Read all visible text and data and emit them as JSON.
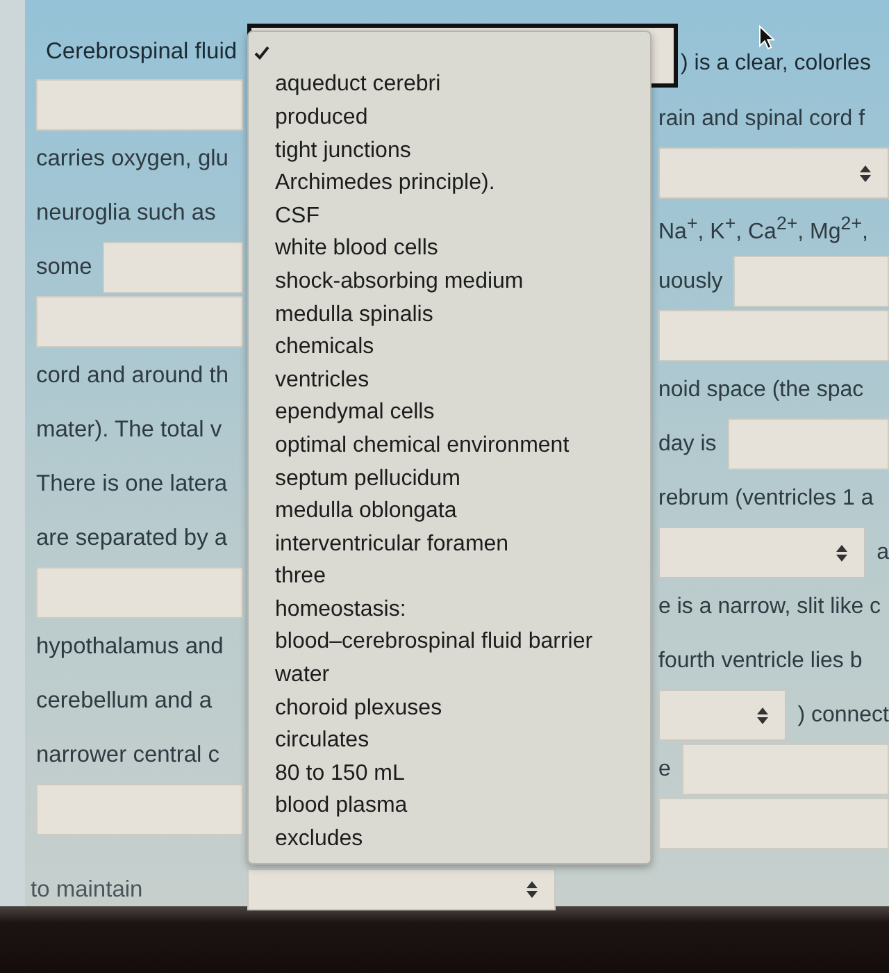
{
  "worksheet": {
    "first_line": {
      "lead": "Cerebrospinal fluid",
      "select": {
        "expanded": true
      },
      "trail": ") is a clear, colorles"
    },
    "left_column": [
      {
        "kind": "input"
      },
      {
        "kind": "text",
        "text": "carries oxygen, glu"
      },
      {
        "kind": "text",
        "text": "neuroglia such as"
      },
      {
        "kind": "text_input",
        "text": "some"
      },
      {
        "kind": "input"
      },
      {
        "kind": "text",
        "text": "cord and around th"
      },
      {
        "kind": "text",
        "text": "mater). The total v"
      },
      {
        "kind": "text",
        "text": "There is one latera"
      },
      {
        "kind": "text",
        "text": "are separated by a"
      },
      {
        "kind": "input"
      },
      {
        "kind": "text",
        "text": "hypothalamus and"
      },
      {
        "kind": "text",
        "text": "cerebellum and a"
      },
      {
        "kind": "text",
        "text": "narrower central c"
      },
      {
        "kind": "input"
      }
    ],
    "right_column": [
      {
        "kind": "text",
        "text": "rain and spinal cord f"
      },
      {
        "kind": "select"
      },
      {
        "kind": "text",
        "text": "Na$^{+}$, K$^{+}$, Ca$^{2+}$, Mg$^{2+}$,"
      },
      {
        "kind": "text_input",
        "text": "uously"
      },
      {
        "kind": "input"
      },
      {
        "kind": "text",
        "text": "noid space (the spac"
      },
      {
        "kind": "text_input",
        "text": "day is"
      },
      {
        "kind": "text",
        "text": "rebrum (ventricles 1 a"
      },
      {
        "kind": "select_text",
        "text": "a"
      },
      {
        "kind": "text",
        "text": "e is a narrow, slit like c"
      },
      {
        "kind": "text",
        "text": "fourth ventricle lies b"
      },
      {
        "kind": "select_text",
        "text": ") connect"
      },
      {
        "kind": "text_input",
        "text": "e"
      },
      {
        "kind": "input"
      }
    ],
    "last_line": {
      "kind": "text_select",
      "text": "to maintain"
    }
  },
  "dropdown": {
    "options": [
      {
        "selected": true
      },
      {
        "label": "aqueduct cerebri",
        "selected": false
      },
      {
        "label": "produced",
        "selected": false
      },
      {
        "label": "tight junctions",
        "selected": false
      },
      {
        "label": "Archimedes principle).",
        "selected": false
      },
      {
        "label": "CSF",
        "selected": false
      },
      {
        "label": "white blood cells",
        "selected": false
      },
      {
        "label": "shock-absorbing medium",
        "selected": false
      },
      {
        "label": "medulla spinalis",
        "selected": false
      },
      {
        "label": "chemicals",
        "selected": false
      },
      {
        "label": "ventricles",
        "selected": false
      },
      {
        "label": "ependymal cells",
        "selected": false
      },
      {
        "label": "optimal chemical environment",
        "selected": false
      },
      {
        "label": "septum pellucidum",
        "selected": false
      },
      {
        "label": "medulla oblongata",
        "selected": false
      },
      {
        "label": "interventricular foramen",
        "selected": false
      },
      {
        "label": "three",
        "selected": false
      },
      {
        "label": "homeostasis:",
        "selected": false
      },
      {
        "label": "blood–cerebrospinal fluid barrier",
        "selected": false
      },
      {
        "label": "water",
        "selected": false
      },
      {
        "label": "choroid plexuses",
        "selected": false
      },
      {
        "label": "circulates",
        "selected": false
      },
      {
        "label": "80 to 150 mL",
        "selected": false
      },
      {
        "label": "blood plasma",
        "selected": false
      },
      {
        "label": "excludes",
        "selected": false
      }
    ]
  }
}
